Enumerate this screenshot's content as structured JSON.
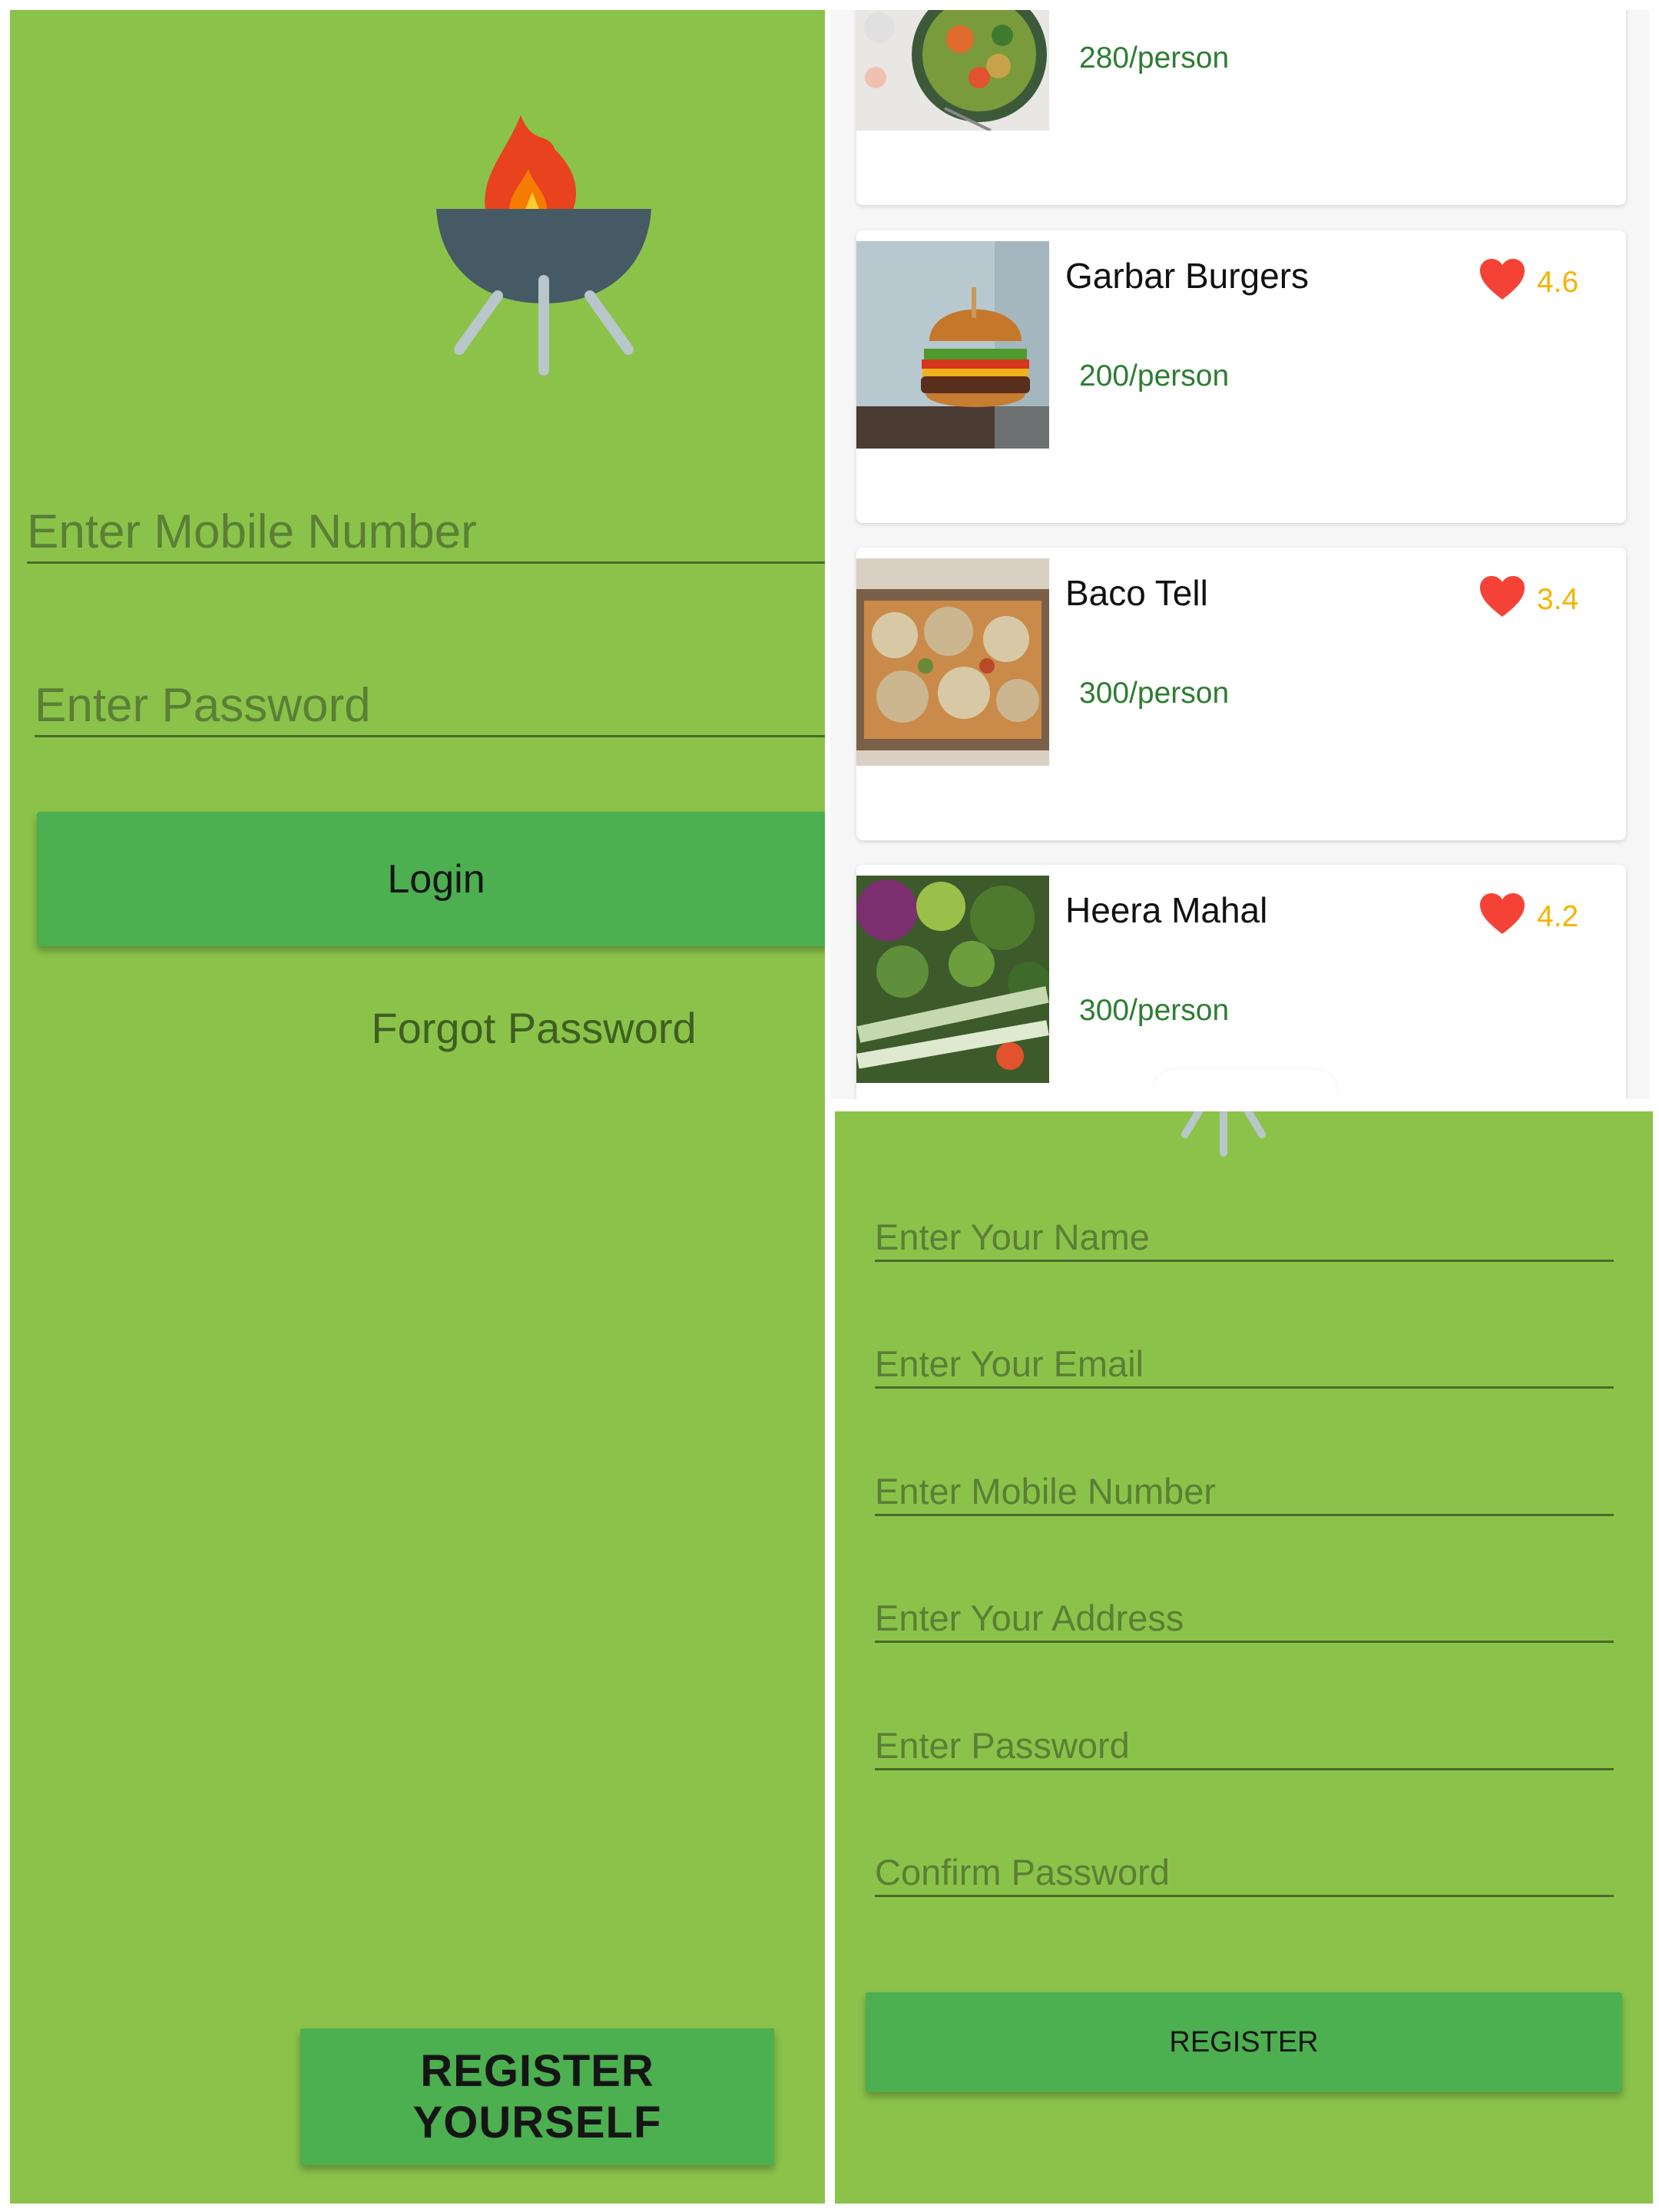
{
  "colors": {
    "app_green": "#8bc34a",
    "button_green": "#4caf50",
    "price_green": "#2e7d32",
    "rating_yellow": "#f5b400",
    "heart_red": "#f44336"
  },
  "login": {
    "logo_icon": "grill-icon",
    "mobile_placeholder": "Enter Mobile Number",
    "password_placeholder": "Enter Password",
    "login_label": "Login",
    "forgot_label": "Forgot Password",
    "register_label": "REGISTER YOURSELF"
  },
  "restaurants": [
    {
      "name": "",
      "price": "280/person",
      "rating": "",
      "image": "salad-bowl-photo"
    },
    {
      "name": "Garbar Burgers",
      "price": "200/person",
      "rating": "4.6",
      "image": "burger-photo"
    },
    {
      "name": "Baco Tell",
      "price": "300/person",
      "rating": "3.4",
      "image": "nachos-photo"
    },
    {
      "name": "Heera Mahal",
      "price": "300/person",
      "rating": "4.2",
      "image": "vegetables-photo"
    }
  ],
  "register": {
    "name_placeholder": "Enter Your Name",
    "email_placeholder": "Enter Your Email",
    "mobile_placeholder": "Enter Mobile Number",
    "address_placeholder": "Enter Your Address",
    "password_placeholder": "Enter Password",
    "confirm_placeholder": "Confirm Password",
    "register_label": "REGISTER"
  }
}
